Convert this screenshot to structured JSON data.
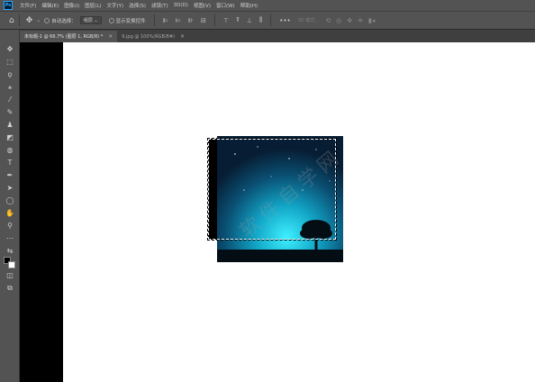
{
  "app": {
    "logo": "Ps"
  },
  "menu": [
    "文件(F)",
    "编辑(E)",
    "图像(I)",
    "图层(L)",
    "文字(Y)",
    "选择(S)",
    "滤镜(T)",
    "3D(D)",
    "视图(V)",
    "窗口(W)",
    "帮助(H)"
  ],
  "options": {
    "auto_select_label": "自动选择：",
    "auto_select_value": "组层",
    "show_transform_label": "显示变换控件",
    "mode_3d_label": "3D 模式："
  },
  "tabs": [
    {
      "label": "未标题-1 @ 66.7% (图层 1, RGB/8) *",
      "close": "×"
    },
    {
      "label": "9.jpg @ 100%(RGB/8#)",
      "close": "×"
    }
  ],
  "watermark": "软件自学网",
  "colors": {
    "accent": "#31a8ff",
    "panel": "#535353",
    "canvas_bg": "#282828"
  },
  "icons": [
    "home-icon",
    "move-icon",
    "marquee-icon",
    "lasso-icon",
    "magic-wand-icon",
    "crop-icon",
    "eyedropper-icon",
    "brush-icon",
    "stamp-icon",
    "eraser-icon",
    "gradient-icon",
    "dodge-icon",
    "pen-icon",
    "type-icon",
    "path-select-icon",
    "shape-icon",
    "hand-icon",
    "zoom-icon"
  ]
}
